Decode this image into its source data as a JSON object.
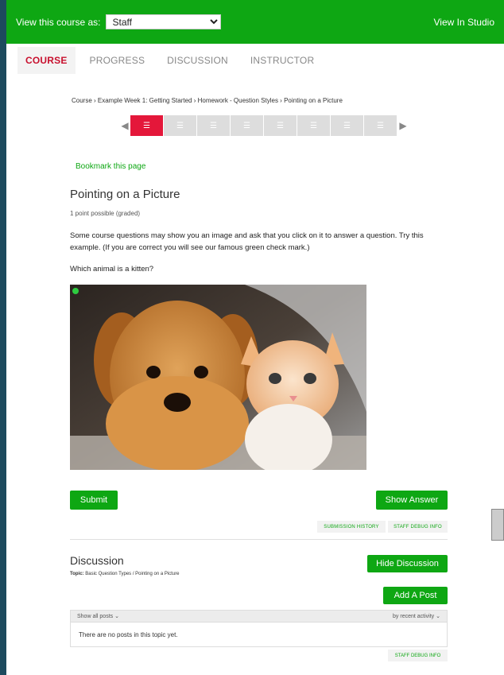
{
  "topbar": {
    "view_label": "View this course as:",
    "view_as_value": "Staff",
    "studio_link": "View In Studio"
  },
  "tabs": [
    {
      "label": "COURSE",
      "active": true
    },
    {
      "label": "PROGRESS",
      "active": false
    },
    {
      "label": "DISCUSSION",
      "active": false
    },
    {
      "label": "INSTRUCTOR",
      "active": false
    }
  ],
  "breadcrumb": "Course › Example Week 1: Getting Started › Homework - Question Styles › Pointing on a Picture",
  "bookmark_label": "Bookmark this page",
  "problem": {
    "title": "Pointing on a Picture",
    "points": "1 point possible (graded)",
    "description": "Some course questions may show you an image and ask that you click on it to answer a question. Try this example. (If you are correct you will see our famous green check mark.)",
    "question": "Which animal is a kitten?",
    "submit_label": "Submit",
    "show_answer_label": "Show Answer",
    "submission_history_label": "SUBMISSION HISTORY",
    "staff_debug_label": "STAFF DEBUG INFO"
  },
  "discussion": {
    "title": "Discussion",
    "topic_label": "Topic:",
    "topic_value": "Basic Question Types / Pointing on a Picture",
    "hide_label": "Hide Discussion",
    "add_post_label": "Add A Post",
    "filter_label": "Show all posts",
    "sort_label": "by recent activity",
    "empty_text": "There are no posts in this topic yet.",
    "staff_debug_label": "STAFF DEBUG INFO"
  },
  "colors": {
    "brand_green": "#0ea713",
    "active_red": "#e4173a"
  }
}
